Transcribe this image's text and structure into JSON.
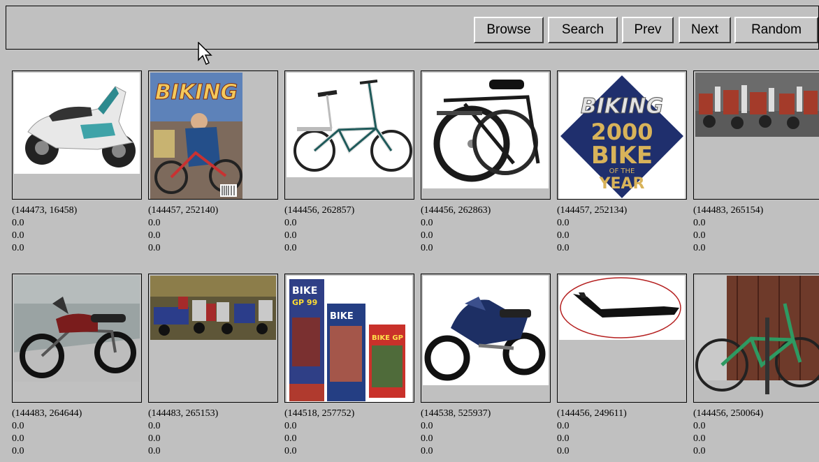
{
  "toolbar": {
    "browse_label": "Browse",
    "search_label": "Search",
    "prev_label": "Prev",
    "next_label": "Next",
    "random_label": "Random"
  },
  "grid": {
    "items": [
      {
        "id": "(144473, 16458)",
        "v1": "0.0",
        "v2": "0.0",
        "v3": "0.0",
        "subject": "scooter"
      },
      {
        "id": "(144457, 252140)",
        "v1": "0.0",
        "v2": "0.0",
        "v3": "0.0",
        "subject": "magazine-cover"
      },
      {
        "id": "(144456, 262857)",
        "v1": "0.0",
        "v2": "0.0",
        "v3": "0.0",
        "subject": "folding-bike"
      },
      {
        "id": "(144456, 262863)",
        "v1": "0.0",
        "v2": "0.0",
        "v3": "0.0",
        "subject": "folding-bike-black"
      },
      {
        "id": "(144457, 252134)",
        "v1": "0.0",
        "v2": "0.0",
        "v3": "0.0",
        "subject": "biking-logo"
      },
      {
        "id": "(144483, 265154)",
        "v1": "0.0",
        "v2": "0.0",
        "v3": "0.0",
        "subject": "motorcycle-lot"
      },
      {
        "id": "(144483, 264644)",
        "v1": "0.0",
        "v2": "0.0",
        "v3": "0.0",
        "subject": "motorcycle-red"
      },
      {
        "id": "(144483, 265153)",
        "v1": "0.0",
        "v2": "0.0",
        "v3": "0.0",
        "subject": "motorcycle-showroom"
      },
      {
        "id": "(144518, 257752)",
        "v1": "0.0",
        "v2": "0.0",
        "v3": "0.0",
        "subject": "video-covers"
      },
      {
        "id": "(144538, 525937)",
        "v1": "0.0",
        "v2": "0.0",
        "v3": "0.0",
        "subject": "motorcycle-blue"
      },
      {
        "id": "(144456, 249611)",
        "v1": "0.0",
        "v2": "0.0",
        "v3": "0.0",
        "subject": "bike-seat"
      },
      {
        "id": "(144456, 250064)",
        "v1": "0.0",
        "v2": "0.0",
        "v3": "0.0",
        "subject": "bike-garage"
      }
    ]
  },
  "artwork": {
    "magazine_title": "BIKING",
    "logo_line1": "BIKING",
    "logo_line2": "2000",
    "logo_line3": "BIKE",
    "logo_line4": "OF THE",
    "logo_line5": "YEAR",
    "video_label_1": "BIKE",
    "video_label_2": "GP 99",
    "video_label_3": "BIKE",
    "video_label_4": "BIKE GP"
  }
}
